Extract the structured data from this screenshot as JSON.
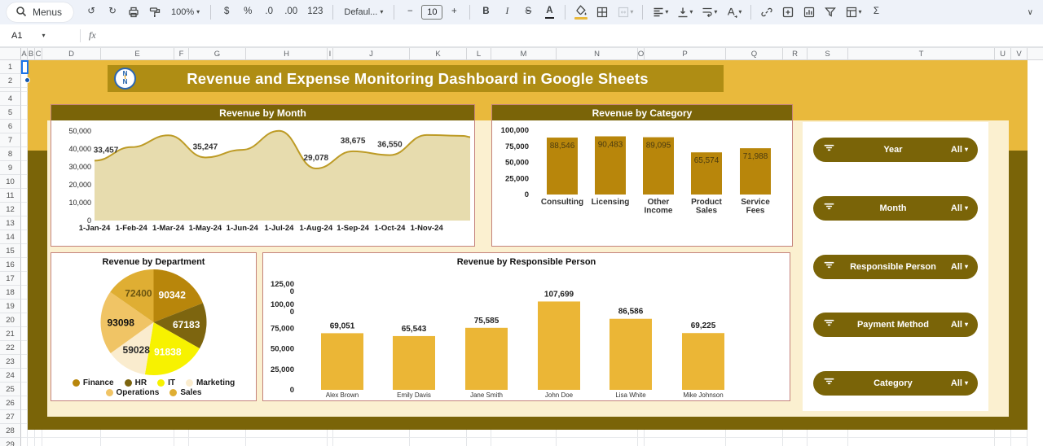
{
  "ui": {
    "caret": "▾",
    "collapse": "∨"
  },
  "toolbar": {
    "items": [
      {
        "name": "menus-button",
        "kind": "search-pill",
        "label": "Menus",
        "icon": "search"
      },
      {
        "name": "undo-button",
        "kind": "glyph",
        "glyph": "↺"
      },
      {
        "name": "redo-button",
        "kind": "glyph",
        "glyph": "↻"
      },
      {
        "name": "print-button",
        "kind": "svg",
        "icon": "print"
      },
      {
        "name": "paint-format-button",
        "kind": "svg",
        "icon": "paint-roller"
      },
      {
        "name": "zoom-select",
        "kind": "dropdown",
        "label": "100%"
      },
      {
        "kind": "divider"
      },
      {
        "name": "format-currency-button",
        "kind": "glyph",
        "glyph": "$"
      },
      {
        "name": "format-percent-button",
        "kind": "glyph",
        "glyph": "%"
      },
      {
        "name": "decrease-decimal-button",
        "kind": "glyph",
        "glyph": ".0"
      },
      {
        "name": "increase-decimal-button",
        "kind": "glyph",
        "glyph": ".00"
      },
      {
        "name": "number-format-button",
        "kind": "glyph",
        "glyph": "123"
      },
      {
        "kind": "divider"
      },
      {
        "name": "font-select",
        "kind": "dropdown",
        "label": "Defaul..."
      },
      {
        "kind": "divider"
      },
      {
        "name": "decrease-font-size-button",
        "kind": "glyph",
        "glyph": "−"
      },
      {
        "name": "font-size-input",
        "kind": "box",
        "label": "10"
      },
      {
        "name": "increase-font-size-button",
        "kind": "glyph",
        "glyph": "+"
      },
      {
        "kind": "divider"
      },
      {
        "name": "bold-button",
        "kind": "glyph",
        "glyph": "B",
        "bold": true
      },
      {
        "name": "italic-button",
        "kind": "glyph",
        "glyph": "I",
        "italic": true
      },
      {
        "name": "strikethrough-button",
        "kind": "glyph",
        "glyph": "S",
        "strike": true
      },
      {
        "name": "text-color-button",
        "kind": "glyph",
        "glyph": "A",
        "underline": "#202124"
      },
      {
        "kind": "divider"
      },
      {
        "name": "fill-color-button",
        "kind": "svg",
        "icon": "paint-bucket",
        "underline": "#E9B93C"
      },
      {
        "name": "borders-button",
        "kind": "svg",
        "icon": "borders"
      },
      {
        "name": "merge-cells-button",
        "kind": "svg",
        "icon": "merge",
        "dropdown": true,
        "disabled": true
      },
      {
        "kind": "divider"
      },
      {
        "name": "horizontal-align-button",
        "kind": "svg",
        "icon": "align-left",
        "dropdown": true
      },
      {
        "name": "vertical-align-button",
        "kind": "svg",
        "icon": "vertical-align",
        "dropdown": true
      },
      {
        "name": "text-wrap-button",
        "kind": "svg",
        "icon": "text-wrap",
        "dropdown": true
      },
      {
        "name": "text-rotation-button",
        "kind": "svg",
        "icon": "text-rotation",
        "dropdown": true
      },
      {
        "kind": "divider"
      },
      {
        "name": "insert-link-button",
        "kind": "svg",
        "icon": "link"
      },
      {
        "name": "insert-comment-button",
        "kind": "svg",
        "icon": "comment"
      },
      {
        "name": "insert-chart-button",
        "kind": "svg",
        "icon": "chart"
      },
      {
        "name": "create-filter-button",
        "kind": "svg",
        "icon": "funnel"
      },
      {
        "name": "table-views-button",
        "kind": "svg",
        "icon": "table",
        "dropdown": true
      },
      {
        "name": "functions-button",
        "kind": "glyph",
        "glyph": "Σ"
      }
    ]
  },
  "formula_bar": {
    "name_box": "A1",
    "fx_label": "fx"
  },
  "grid": {
    "column_letters": [
      "A",
      "B",
      "C",
      "D",
      "E",
      "F",
      "G",
      "H",
      "I",
      "J",
      "K",
      "L",
      "M",
      "N",
      "O",
      "P",
      "Q",
      "R",
      "S",
      "T",
      "U",
      "V"
    ],
    "row_numbers": [
      "1",
      "2",
      "4",
      "5",
      "6",
      "7",
      "8",
      "9",
      "10",
      "11",
      "12",
      "13",
      "14",
      "15",
      "16",
      "17",
      "18",
      "19",
      "20",
      "21",
      "22",
      "23",
      "24",
      "25",
      "26",
      "27",
      "28",
      "29"
    ]
  },
  "dashboard": {
    "title": "Revenue and Expense Monitoring Dashboard in Google Sheets",
    "logo_letters": [
      "N",
      "t",
      "N"
    ],
    "filters": [
      {
        "label": "Year",
        "value": "All"
      },
      {
        "label": "Month",
        "value": "All"
      },
      {
        "label": "Responsible Person",
        "value": "All"
      },
      {
        "label": "Payment Method",
        "value": "All"
      },
      {
        "label": "Category",
        "value": "All"
      }
    ]
  },
  "colors": {
    "background_yellow": "#E9B93C",
    "title_band": "#AF8D14",
    "frame_olive": "#7A6408",
    "cream": "#FBF0D0",
    "card_border": "#C4827B",
    "area_fill": "#E7DCAE",
    "area_line": "#BD9B26",
    "category_bar": "#B8860B",
    "person_bar": "#EBB636",
    "selection_blue": "#1a73e8"
  },
  "chart_data": [
    {
      "type": "area",
      "title": "Revenue by Month",
      "x_labels": [
        "1-Jan-24",
        "1-Feb-24",
        "1-Mar-24",
        "1-May-24",
        "1-Jun-24",
        "1-Jul-24",
        "1-Aug-24",
        "1-Sep-24",
        "1-Oct-24",
        "1-Nov-24"
      ],
      "values": [
        33457,
        41000,
        47600,
        35247,
        39500,
        50100,
        29078,
        38675,
        36550,
        47800
      ],
      "trailing_value": 47300,
      "point_labels": [
        "33,457",
        null,
        null,
        "35,247",
        null,
        null,
        "29,078",
        "38,675",
        "36,550",
        null
      ],
      "y_ticks": [
        "0",
        "10,000",
        "20,000",
        "30,000",
        "40,000",
        "50,000"
      ],
      "ylim": [
        0,
        50000
      ],
      "grid": false,
      "legend": "none"
    },
    {
      "type": "bar",
      "title": "Revenue by Category",
      "categories": [
        "Consulting",
        "Licensing",
        "Other Income",
        "Product Sales",
        "Service Fees"
      ],
      "values": [
        88546,
        90483,
        89095,
        65574,
        71988
      ],
      "value_labels": [
        "88,546",
        "90,483",
        "89,095",
        "65,574",
        "71,988"
      ],
      "y_ticks": [
        "0",
        "25,000",
        "50,000",
        "75,000",
        "100,000"
      ],
      "ylim": [
        0,
        100000
      ],
      "label_position": "inside-top"
    },
    {
      "type": "pie",
      "title": "Revenue by Department",
      "slices": [
        {
          "label": "Finance",
          "value": 90342,
          "display": "90342",
          "color": "#B8860B",
          "text_color": "#ffffff"
        },
        {
          "label": "HR",
          "value": 67183,
          "display": "67183",
          "color": "#7D650F",
          "text_color": "#ffffff"
        },
        {
          "label": "IT",
          "value": 91838,
          "display": "91838",
          "color": "#F7F200",
          "text_color": "#ffffff"
        },
        {
          "label": "Marketing",
          "value": 59028,
          "display": "59028",
          "color": "#FAECCE",
          "text_color": "#2b2b2b"
        },
        {
          "label": "Operations",
          "value": 93098,
          "display": "93098",
          "color": "#F0C465",
          "text_color": "#111111"
        },
        {
          "label": "Sales",
          "value": 72400,
          "display": "72400",
          "color": "#DFAE33",
          "text_color": "#6b5510"
        }
      ],
      "legend_rows": [
        [
          "Finance",
          "HR",
          "IT",
          "Marketing"
        ],
        [
          "Operations",
          "Sales"
        ]
      ]
    },
    {
      "type": "bar",
      "title": "Revenue by Responsible Person",
      "categories": [
        "Alex Brown",
        "Emily Davis",
        "Jane Smith",
        "John Doe",
        "Lisa White",
        "Mike Johnson"
      ],
      "values": [
        69051,
        65543,
        75585,
        107699,
        86586,
        69225
      ],
      "value_labels": [
        "69,051",
        "65,543",
        "75,585",
        "107,699",
        "86,586",
        "69,225"
      ],
      "y_ticks": [
        "0",
        "25,000",
        "50,000",
        "75,000",
        [
          "100,00",
          "0"
        ],
        [
          "125,00",
          "0"
        ]
      ],
      "ylim": [
        0,
        125000
      ],
      "label_position": "above"
    }
  ]
}
